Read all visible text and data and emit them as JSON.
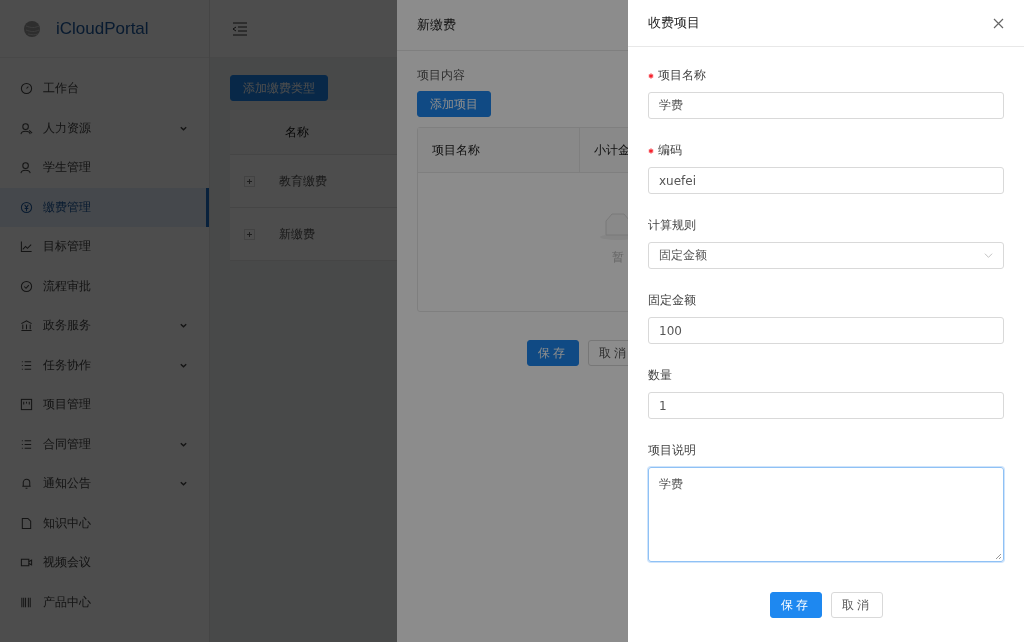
{
  "sidebar": {
    "logo": "iCloudPortal",
    "items": [
      {
        "label": "工作台",
        "expandable": false,
        "selected": false
      },
      {
        "label": "人力资源",
        "expandable": true,
        "selected": false
      },
      {
        "label": "学生管理",
        "expandable": false,
        "selected": false
      },
      {
        "label": "缴费管理",
        "expandable": false,
        "selected": true
      },
      {
        "label": "目标管理",
        "expandable": false,
        "selected": false
      },
      {
        "label": "流程审批",
        "expandable": false,
        "selected": false
      },
      {
        "label": "政务服务",
        "expandable": true,
        "selected": false
      },
      {
        "label": "任务协作",
        "expandable": true,
        "selected": false
      },
      {
        "label": "项目管理",
        "expandable": false,
        "selected": false
      },
      {
        "label": "合同管理",
        "expandable": true,
        "selected": false
      },
      {
        "label": "通知公告",
        "expandable": true,
        "selected": false
      },
      {
        "label": "知识中心",
        "expandable": false,
        "selected": false
      },
      {
        "label": "视频会议",
        "expandable": false,
        "selected": false
      },
      {
        "label": "产品中心",
        "expandable": false,
        "selected": false
      }
    ]
  },
  "main": {
    "add_button": "添加缴费类型",
    "table": {
      "columns": [
        "名称"
      ],
      "rows": [
        {
          "name": "教育缴费",
          "expanded": false
        },
        {
          "name": "新缴费",
          "expanded": false
        }
      ]
    }
  },
  "drawer_back": {
    "title": "新缴费",
    "section_label": "项目内容",
    "add_button": "添加项目",
    "table": {
      "columns": [
        "项目名称",
        "小计金"
      ],
      "empty_text": "暂"
    },
    "buttons": [
      {
        "label": "保存",
        "kind": "primary"
      },
      {
        "label": "取消",
        "kind": "default"
      }
    ]
  },
  "drawer": {
    "title": "收费项目",
    "fields": [
      {
        "label": "项目名称",
        "required": true,
        "kind": "input",
        "value": "学费",
        "focused": false
      },
      {
        "label": "编码",
        "required": true,
        "kind": "input",
        "value": "xuefei",
        "focused": false
      },
      {
        "label": "计算规则",
        "required": false,
        "kind": "select",
        "value": "固定金额",
        "focused": false
      },
      {
        "label": "固定金额",
        "required": false,
        "kind": "input",
        "value": "100",
        "focused": false
      },
      {
        "label": "数量",
        "required": false,
        "kind": "input",
        "value": "1",
        "focused": false
      },
      {
        "label": "项目说明",
        "required": false,
        "kind": "textarea",
        "value": "学费",
        "focused": true
      }
    ],
    "buttons": [
      {
        "label": "保存",
        "kind": "primary"
      },
      {
        "label": "取消",
        "kind": "default"
      }
    ]
  }
}
